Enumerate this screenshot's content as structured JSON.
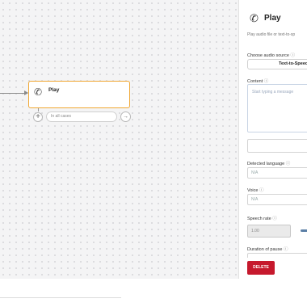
{
  "canvas": {
    "node": {
      "title": "Play",
      "icon": "phone-sound-icon"
    },
    "case_pill": "In all cases",
    "add_symbol": "+",
    "arrow_symbol": "→"
  },
  "panel": {
    "icon": "phone-sound-icon",
    "title": "Play",
    "subtitle": "Play audio file or text-to-sp",
    "audio_source": {
      "label": "Choose audio source",
      "value": "Text-to-Speec"
    },
    "content": {
      "label": "Content",
      "placeholder": "Start typing a message"
    },
    "detected_language": {
      "label": "Detected language",
      "value": "N/A"
    },
    "voice": {
      "label": "Voice",
      "value": "N/A"
    },
    "speech_rate": {
      "label": "Speech rate",
      "value": "1.00"
    },
    "duration_of_pause": {
      "label": "Duration of pause"
    },
    "info_symbol": "ⓘ",
    "delete_label": "DELETE"
  },
  "colors": {
    "node_border": "#f0a733",
    "delete_button": "#c6192d",
    "slider": "#5b7fa6"
  }
}
